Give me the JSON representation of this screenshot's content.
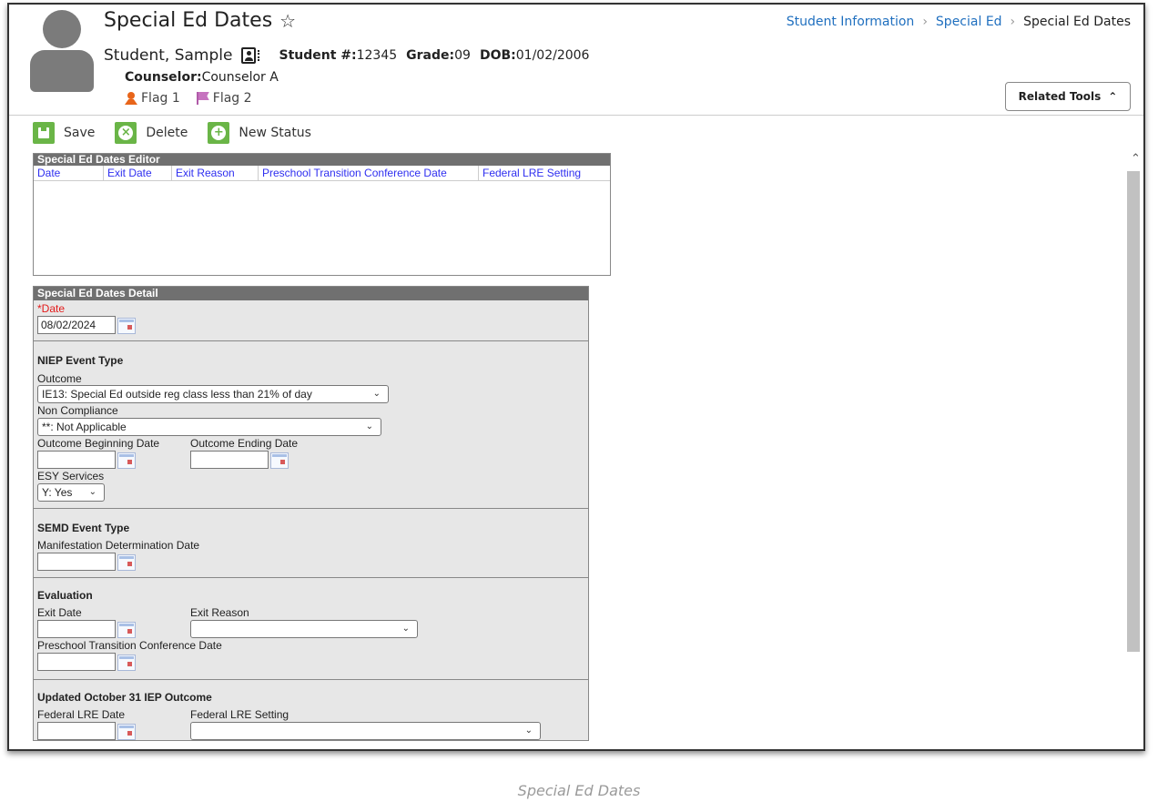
{
  "header": {
    "title": "Special Ed Dates",
    "student_name": "Student, Sample",
    "student_number_label": "Student #:",
    "student_number": "12345",
    "grade_label": "Grade:",
    "grade": "09",
    "dob_label": "DOB:",
    "dob": "01/02/2006",
    "counselor_label": "Counselor:",
    "counselor": "Counselor A",
    "flags": [
      "Flag 1",
      "Flag 2"
    ],
    "related_tools": "Related Tools"
  },
  "breadcrumb": {
    "items": [
      "Student Information",
      "Special Ed",
      "Special Ed Dates"
    ]
  },
  "toolbar": {
    "save": "Save",
    "delete": "Delete",
    "new_status": "New Status"
  },
  "editor": {
    "title": "Special Ed Dates Editor",
    "columns": [
      "Date",
      "Exit Date",
      "Exit Reason",
      "Preschool Transition Conference Date",
      "Federal LRE Setting"
    ]
  },
  "detail": {
    "title": "Special Ed Dates Detail",
    "date_label": "*Date",
    "date_value": "08/02/2024",
    "niep": {
      "title": "NIEP Event Type",
      "outcome_label": "Outcome",
      "outcome_value": "IE13: Special Ed outside reg class less than 21% of day",
      "noncompliance_label": "Non Compliance",
      "noncompliance_value": "**: Not Applicable",
      "outcome_begin_label": "Outcome Beginning Date",
      "outcome_end_label": "Outcome Ending Date",
      "esy_label": "ESY Services",
      "esy_value": "Y: Yes"
    },
    "semd": {
      "title": "SEMD Event Type",
      "manifestation_label": "Manifestation Determination Date"
    },
    "evaluation": {
      "title": "Evaluation",
      "exit_date_label": "Exit Date",
      "exit_reason_label": "Exit Reason",
      "preschool_label": "Preschool Transition Conference Date"
    },
    "updated": {
      "title": "Updated October 31 IEP Outcome",
      "lre_date_label": "Federal LRE Date",
      "lre_setting_label": "Federal LRE Setting"
    }
  },
  "caption": "Special Ed Dates"
}
